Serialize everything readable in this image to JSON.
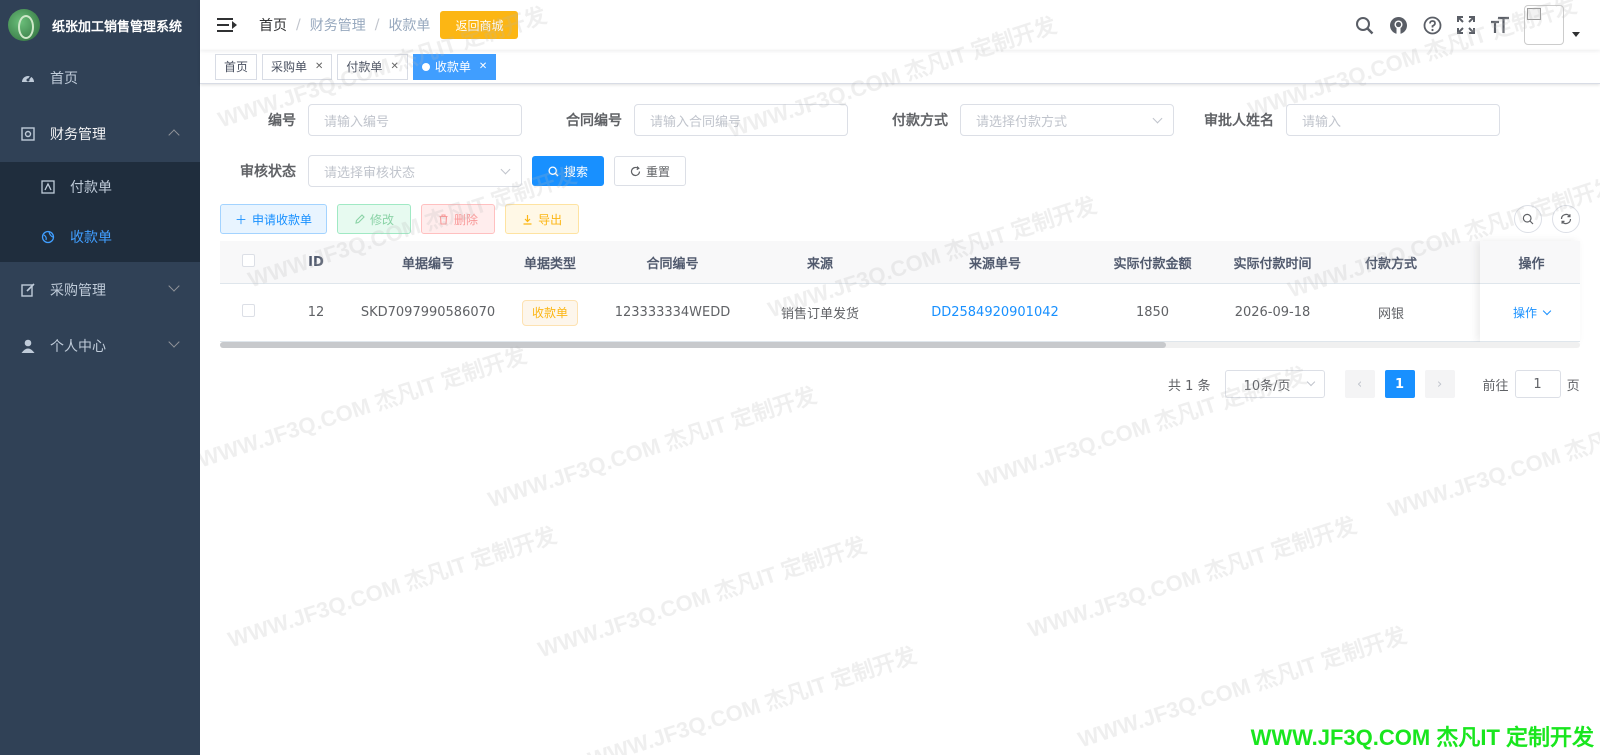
{
  "app": {
    "title": "纸张加工销售管理系统"
  },
  "sidebar": {
    "items": [
      {
        "label": "首页"
      },
      {
        "label": "财务管理",
        "children": [
          {
            "label": "付款单"
          },
          {
            "label": "收款单"
          }
        ]
      },
      {
        "label": "采购管理"
      },
      {
        "label": "个人中心"
      }
    ]
  },
  "header": {
    "breadcrumb": [
      "首页",
      "财务管理",
      "收款单"
    ],
    "back_button": "返回商城"
  },
  "tags": [
    {
      "label": "首页"
    },
    {
      "label": "采购单"
    },
    {
      "label": "付款单"
    },
    {
      "label": "收款单"
    }
  ],
  "search": {
    "code_label": "编号",
    "code_placeholder": "请输入编号",
    "contract_label": "合同编号",
    "contract_placeholder": "请输入合同编号",
    "pay_label": "付款方式",
    "pay_placeholder": "请选择付款方式",
    "approver_label": "审批人姓名",
    "approver_placeholder": "请输入",
    "status_label": "审核状态",
    "status_placeholder": "请选择审核状态",
    "search_button": "搜索",
    "reset_button": "重置"
  },
  "toolbar": {
    "add": "申请收款单",
    "edit": "修改",
    "delete": "删除",
    "export": "导出"
  },
  "table": {
    "columns": [
      "ID",
      "单据编号",
      "单据类型",
      "合同编号",
      "来源",
      "来源单号",
      "实际付款金额",
      "实际付款时间",
      "付款方式",
      "操作"
    ],
    "rows": [
      {
        "id": "12",
        "code": "SKD7097990586070",
        "type": "收款单",
        "contract": "123333334WEDD",
        "source": "销售订单发货",
        "source_no": "DD2584920901042",
        "amount": "1850",
        "time": "2026-09-18",
        "pay": "网银",
        "op": "操作"
      }
    ]
  },
  "pagination": {
    "total": "共 1 条",
    "size": "10条/页",
    "current": "1",
    "goto_prefix": "前往",
    "goto_value": "1",
    "goto_suffix": "页"
  },
  "watermark": {
    "text": "WWW.JF3Q.COM 杰凡IT  定制开发",
    "footer": "WWW.JF3Q.COM 杰凡IT  定制开发"
  },
  "colors": {
    "sidebar": "#304156",
    "primary": "#1890ff",
    "warning": "#fcb614",
    "active_menu": "#409eff"
  }
}
